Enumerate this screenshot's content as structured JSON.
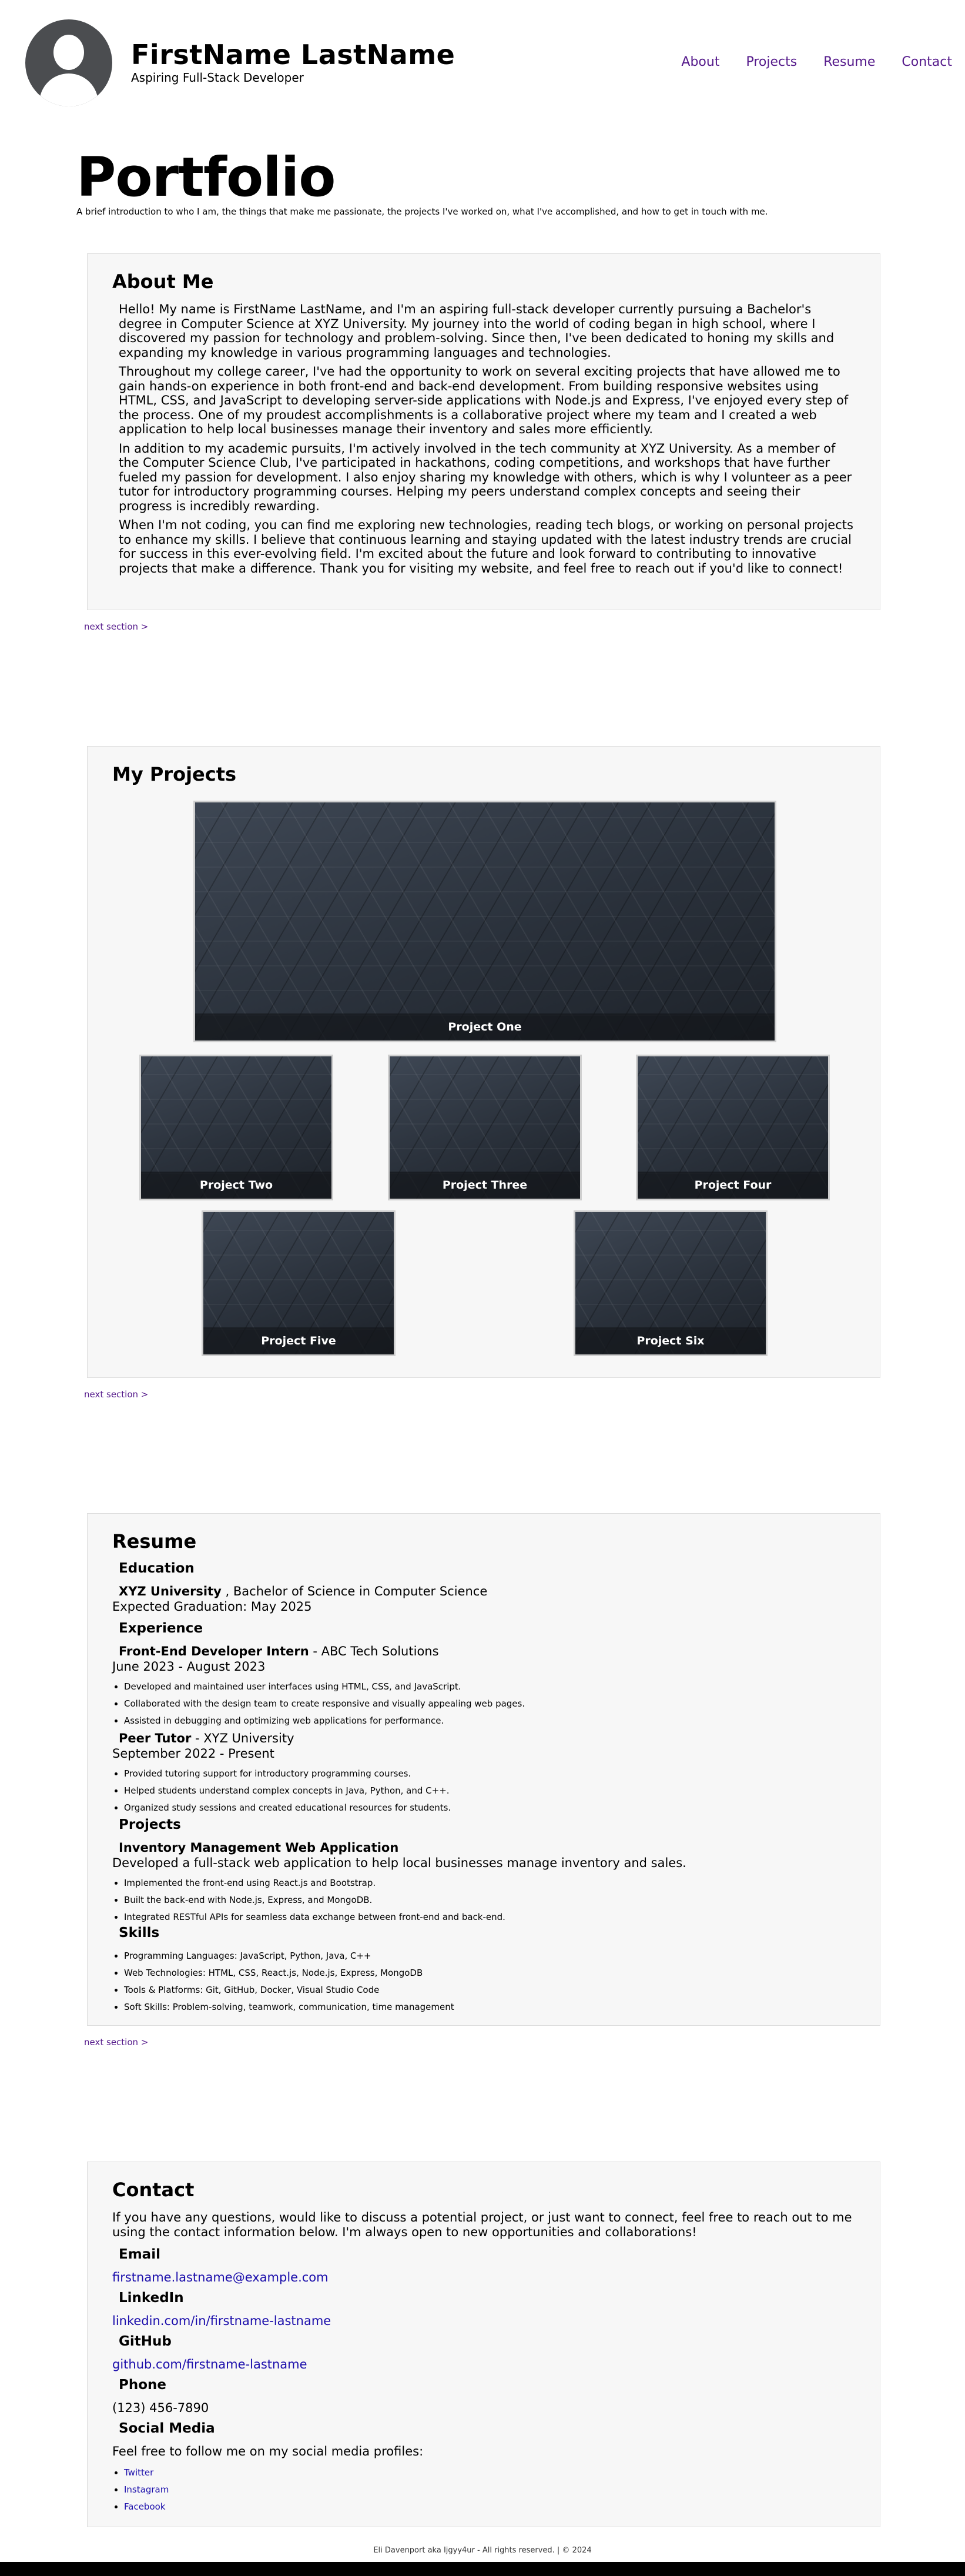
{
  "header": {
    "name": "FirstName LastName",
    "tagline": "Aspiring Full-Stack Developer",
    "nav": [
      "About",
      "Projects",
      "Resume",
      "Contact"
    ]
  },
  "page": {
    "title": "Portfolio",
    "intro": "A brief introduction to who I am, the things that make me passionate, the projects I've worked on, what I've accomplished, and how to get in touch with me."
  },
  "about": {
    "heading": "About Me",
    "paragraphs": [
      "Hello! My name is FirstName LastName, and I'm an aspiring full-stack developer currently pursuing a Bachelor's degree in Computer Science at XYZ University. My journey into the world of coding began in high school, where I discovered my passion for technology and problem-solving. Since then, I've been dedicated to honing my skills and expanding my knowledge in various programming languages and technologies.",
      "Throughout my college career, I've had the opportunity to work on several exciting projects that have allowed me to gain hands-on experience in both front-end and back-end development. From building responsive websites using HTML, CSS, and JavaScript to developing server-side applications with Node.js and Express, I've enjoyed every step of the process. One of my proudest accomplishments is a collaborative project where my team and I created a web application to help local businesses manage their inventory and sales more efficiently.",
      "In addition to my academic pursuits, I'm actively involved in the tech community at XYZ University. As a member of the Computer Science Club, I've participated in hackathons, coding competitions, and workshops that have further fueled my passion for development. I also enjoy sharing my knowledge with others, which is why I volunteer as a peer tutor for introductory programming courses. Helping my peers understand complex concepts and seeing their progress is incredibly rewarding.",
      "When I'm not coding, you can find me exploring new technologies, reading tech blogs, or working on personal projects to enhance my skills. I believe that continuous learning and staying updated with the latest industry trends are crucial for success in this ever-evolving field. I'm excited about the future and look forward to contributing to innovative projects that make a difference. Thank you for visiting my website, and feel free to reach out if you'd like to connect!"
    ],
    "next": "next section >"
  },
  "projects": {
    "heading": "My Projects",
    "items": [
      "Project One",
      "Project Two",
      "Project Three",
      "Project Four",
      "Project Five",
      "Project Six"
    ],
    "next": "next section >"
  },
  "resume": {
    "heading": "Resume",
    "education_heading": "Education",
    "school": "XYZ University",
    "degree": ", Bachelor of Science in Computer Science",
    "graduation": "Expected Graduation: May 2025",
    "experience_heading": "Experience",
    "job1_title": "Front-End Developer Intern",
    "job1_company": "- ABC Tech Solutions",
    "job1_dates": "June 2023 - August 2023",
    "job1_bullets": [
      "Developed and maintained user interfaces using HTML, CSS, and JavaScript.",
      "Collaborated with the design team to create responsive and visually appealing web pages.",
      "Assisted in debugging and optimizing web applications for performance."
    ],
    "job2_title": "Peer Tutor",
    "job2_company": "- XYZ University",
    "job2_dates": "September 2022 - Present",
    "job2_bullets": [
      "Provided tutoring support for introductory programming courses.",
      "Helped students understand complex concepts in Java, Python, and C++.",
      "Organized study sessions and created educational resources for students."
    ],
    "projects_heading": "Projects",
    "project_title": "Inventory Management Web Application",
    "project_desc": "Developed a full-stack web application to help local businesses manage inventory and sales.",
    "project_bullets": [
      "Implemented the front-end using React.js and Bootstrap.",
      "Built the back-end with Node.js, Express, and MongoDB.",
      "Integrated RESTful APIs for seamless data exchange between front-end and back-end."
    ],
    "skills_heading": "Skills",
    "skills_bullets": [
      "Programming Languages: JavaScript, Python, Java, C++",
      "Web Technologies: HTML, CSS, React.js, Node.js, Express, MongoDB",
      "Tools & Platforms: Git, GitHub, Docker, Visual Studio Code",
      "Soft Skills: Problem-solving, teamwork, communication, time management"
    ],
    "next": "next section >"
  },
  "contact": {
    "heading": "Contact",
    "intro": "If you have any questions, would like to discuss a potential project, or just want to connect, feel free to reach out to me using the contact information below. I'm always open to new opportunities and collaborations!",
    "email_heading": "Email",
    "email": "firstname.lastname@example.com",
    "linkedin_heading": "LinkedIn",
    "linkedin": "linkedin.com/in/firstname-lastname",
    "github_heading": "GitHub",
    "github": "github.com/firstname-lastname",
    "phone_heading": "Phone",
    "phone": "(123) 456-7890",
    "social_heading": "Social Media",
    "social_intro": "Feel free to follow me on my social media profiles:",
    "social_links": [
      "Twitter",
      "Instagram",
      "Facebook"
    ]
  },
  "footer": {
    "text": "Eli Davenport aka Ijgyy4ur - All rights reserved. | © 2024"
  }
}
